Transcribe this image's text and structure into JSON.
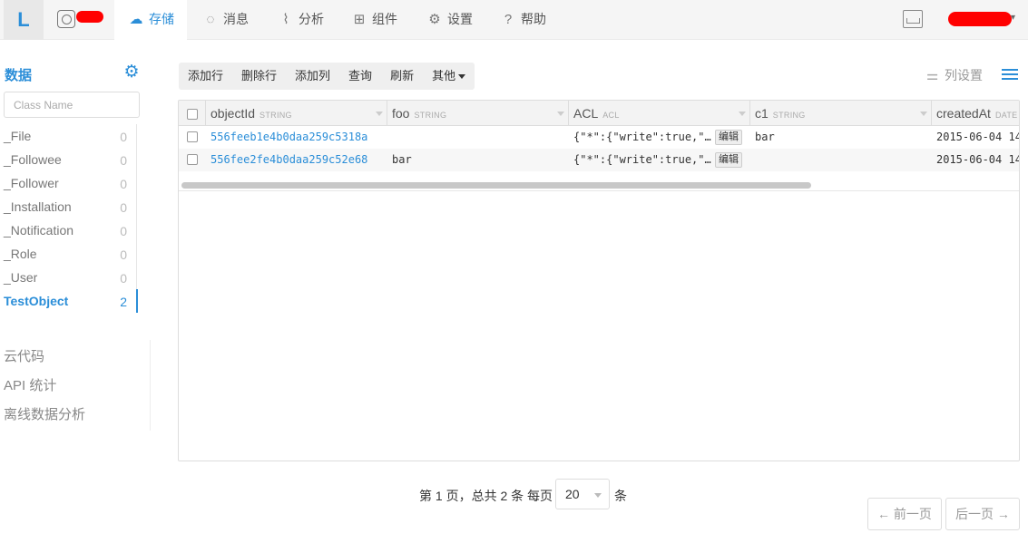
{
  "brand": {
    "logo": "L"
  },
  "nav": {
    "items": [
      {
        "label": "存储",
        "icon": "cloud-upload-icon",
        "glyph": "☁",
        "active": true
      },
      {
        "label": "消息",
        "icon": "chat-icon",
        "glyph": "◌"
      },
      {
        "label": "分析",
        "icon": "chart-icon",
        "glyph": "⌇"
      },
      {
        "label": "组件",
        "icon": "sliders-icon",
        "glyph": "⊞"
      },
      {
        "label": "设置",
        "icon": "gear-icon",
        "glyph": "⚙"
      },
      {
        "label": "帮助",
        "icon": "help-icon",
        "glyph": "?"
      }
    ]
  },
  "sidebar": {
    "title": "数据",
    "search_placeholder": "Class Name",
    "classes": [
      {
        "name": "_File",
        "count": "0"
      },
      {
        "name": "_Followee",
        "count": "0"
      },
      {
        "name": "_Follower",
        "count": "0"
      },
      {
        "name": "_Installation",
        "count": "0"
      },
      {
        "name": "_Notification",
        "count": "0"
      },
      {
        "name": "_Role",
        "count": "0"
      },
      {
        "name": "_User",
        "count": "0"
      },
      {
        "name": "TestObject",
        "count": "2",
        "active": true
      }
    ],
    "links": [
      "云代码",
      "API 统计",
      "离线数据分析"
    ]
  },
  "toolbar": {
    "add_row": "添加行",
    "delete_row": "删除行",
    "add_column": "添加列",
    "query": "查询",
    "refresh": "刷新",
    "more": "其他",
    "column_settings": "列设置"
  },
  "table": {
    "columns": [
      {
        "name": "objectId",
        "type": "STRING"
      },
      {
        "name": "foo",
        "type": "STRING"
      },
      {
        "name": "ACL",
        "type": "ACL"
      },
      {
        "name": "c1",
        "type": "STRING"
      },
      {
        "name": "createdAt",
        "type": "DATE"
      }
    ],
    "edit_label": "编辑",
    "rows": [
      {
        "objectId": "556feeb1e4b0daa259c5318a",
        "foo": "",
        "acl": "{\"*\":{\"write\":true,\"…",
        "c1": "bar",
        "createdAt": "2015-06-04 14"
      },
      {
        "objectId": "556fee2fe4b0daa259c52e68",
        "foo": "bar",
        "acl": "{\"*\":{\"write\":true,\"…",
        "c1": "",
        "createdAt": "2015-06-04 14"
      }
    ]
  },
  "pagination": {
    "summary": "第 1 页，总共 2 条 每页",
    "per_page": "20",
    "unit": "条",
    "prev": "← 前一页",
    "next": "后一页 →"
  },
  "colors": {
    "accent": "#2b8ed8"
  }
}
